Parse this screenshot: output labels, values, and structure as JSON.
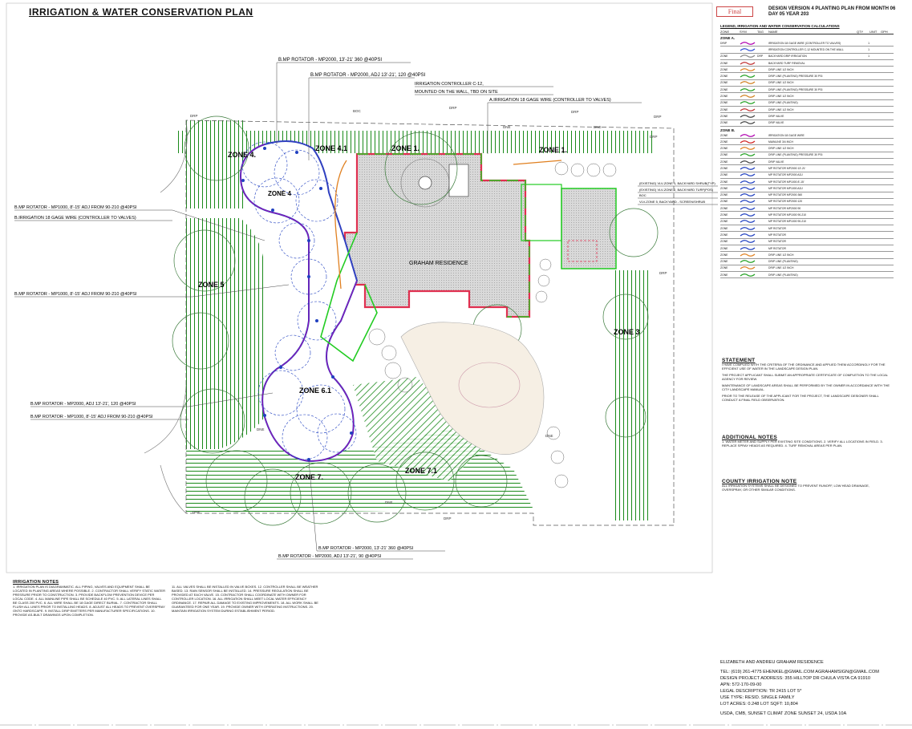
{
  "title": "IRRIGATION & WATER CONSERVATION PLAN",
  "final_stamp": "Final",
  "design_version": {
    "line1": "DESIGN VERSION 4 PLANTING PLAN FROM MONTH 06",
    "line2": "DAY 05 YEAR 203"
  },
  "plan": {
    "residence": "GRAHAM RESIDENCE",
    "zones": [
      "ZONE 4.",
      "ZONE 4.1",
      "ZONE 1.",
      "ZONE 1.",
      "ZONE 5",
      "ZONE 6.1",
      "ZONE 7.",
      "ZONE 7.1",
      "ZONE 3"
    ],
    "zone_inner": "ZONE 4",
    "controller_callout_1": "IRRIGATION CONTROLLER C-12,",
    "controller_callout_2": "MOUNTED ON THE WALL, TBD ON SITE",
    "callouts": {
      "rot_top_1": "B.MP ROTATOR - MP2000, 13'-21' 360 @40PSI",
      "rot_top_2": "B.MP ROTATOR - MP2000, ADJ 13'-21', 120 @40PSI",
      "wire_top": "A.IRRIGATION 18 GAGE WIRE (CONTROLLER TO VALVES)",
      "rot_left_1": "B.MP ROTATOR - MP1000, 8'-15' ADJ FROM 90-210 @40PSI",
      "wire_left": "B.IRRIGATION 18 GAGE WIRE (CONTROLLER TO VALVES)",
      "rot_left_2": "B.MP ROTATOR - MP1000, 8'-15' ADJ FROM 90-210 @40PSI",
      "rot_bl_1": "B.MP ROTATOR - MP2000, ADJ 13'-21', 120 @40PSI",
      "rot_bl_2": "B.MP ROTATOR - MP1000, 8'-15' ADJ FROM 90-210 @40PSI",
      "rot_bot_1": "B.MP ROTATOR - MP2000, 13'-21' 360 @40PSI",
      "rot_bot_2": "B.MP ROTATOR - MP2000, ADJ 13'-21', 90 @40PSI",
      "valve_1": "(EXISTING) VLV-ZONE 1, BACKYARD SHRUB(TYP)",
      "valve_2": "(EXISTING) VLV-ZONE 2, BACKYARD TURF(POS)",
      "valve_3": "VLV-ZONE 5, BACKYARD - SCREEN/SHRUB",
      "boc": "BOC",
      "drp": "DRP",
      "dne": "DNE"
    }
  },
  "legend": {
    "title": "LEGEND, IRRIGATION AND WATER CONSERVATION CALCULATIONS",
    "headers": [
      "ZONE",
      "SYM",
      "TAG",
      "NAME",
      "QTY",
      "UNIT",
      "GPH"
    ],
    "zone_a": "ZONE A.",
    "zone_b": "ZONE B.",
    "rows": [
      {
        "c1": "DRIP",
        "color": "#b000b0",
        "tag": "",
        "name": "IRRIGATION 18 GAGE WIRE (CONTROLLER TO VALVES)",
        "qty": "1",
        "unit": "",
        "gph": ""
      },
      {
        "c1": "",
        "color": "#3050d0",
        "tag": "",
        "name": "IRRIGATION CONTROLLER C-12 MOUNTED ON THE WALL",
        "qty": "1",
        "unit": "",
        "gph": ""
      },
      {
        "c1": "ZONE",
        "color": "#888",
        "tag": "DRP",
        "name": "BACKYARD DRIP IRRIGATION",
        "qty": "1",
        "unit": "",
        "gph": ""
      },
      {
        "c1": "ZONE",
        "color": "#c03030",
        "tag": "",
        "name": "BACKYARD TURF REMOVAL",
        "qty": "",
        "unit": "",
        "gph": ""
      },
      {
        "c1": "ZONE",
        "color": "#e08020",
        "tag": "",
        "name": "DRIP LINE 1/2 INCH",
        "qty": "",
        "unit": "",
        "gph": ""
      },
      {
        "c1": "ZONE",
        "color": "#20a020",
        "tag": "",
        "name": "DRIP LINE (PLANTING) PRESSURE 30 PSI",
        "qty": "",
        "unit": "",
        "gph": ""
      },
      {
        "c1": "ZONE",
        "color": "#d08020",
        "tag": "",
        "name": "DRIP LINE 1/2 INCH",
        "qty": "",
        "unit": "",
        "gph": ""
      },
      {
        "c1": "ZONE",
        "color": "#20a020",
        "tag": "",
        "name": "DRIP LINE (PLANTING) PRESSURE 30 PSI",
        "qty": "",
        "unit": "",
        "gph": ""
      },
      {
        "c1": "ZONE",
        "color": "#d08020",
        "tag": "",
        "name": "DRIP LINE 1/2 INCH",
        "qty": "",
        "unit": "",
        "gph": ""
      },
      {
        "c1": "ZONE",
        "color": "#20a020",
        "tag": "",
        "name": "DRIP LINE (PLANTING)",
        "qty": "",
        "unit": "",
        "gph": ""
      },
      {
        "c1": "ZONE",
        "color": "#c03030",
        "tag": "",
        "name": "DRIP LINE 1/2 INCH",
        "qty": "",
        "unit": "",
        "gph": ""
      },
      {
        "c1": "ZONE",
        "color": "#444",
        "tag": "",
        "name": "DRIP VALVE",
        "qty": "",
        "unit": "",
        "gph": ""
      },
      {
        "c1": "ZONE",
        "color": "#444",
        "tag": "",
        "name": "DRIP VALVE",
        "qty": "",
        "unit": "",
        "gph": ""
      },
      {
        "c1": "ZONE",
        "color": "#b000b0",
        "tag": "",
        "name": "IRRIGATION 18 GAGE WIRE",
        "qty": "",
        "unit": "",
        "gph": ""
      },
      {
        "c1": "ZONE",
        "color": "#d02020",
        "tag": "",
        "name": "MAINLINE 3/4 INCH",
        "qty": "",
        "unit": "",
        "gph": ""
      },
      {
        "c1": "ZONE",
        "color": "#e08020",
        "tag": "",
        "name": "DRIP LINE 1/2 INCH",
        "qty": "",
        "unit": "",
        "gph": ""
      },
      {
        "c1": "ZONE",
        "color": "#20a020",
        "tag": "",
        "name": "DRIP LINE (PLANTING) PRESSURE 30 PSI",
        "qty": "",
        "unit": "",
        "gph": ""
      },
      {
        "c1": "ZONE",
        "color": "#444",
        "tag": "",
        "name": "DRIP VALVE",
        "qty": "",
        "unit": "",
        "gph": ""
      },
      {
        "c1": "ZONE",
        "color": "#2040c0",
        "tag": "",
        "name": "MP ROTATOR MP2000 13'-21'",
        "qty": "",
        "unit": "",
        "gph": ""
      },
      {
        "c1": "ZONE",
        "color": "#2040c0",
        "tag": "",
        "name": "MP ROTATOR MP2000 ADJ",
        "qty": "",
        "unit": "",
        "gph": ""
      },
      {
        "c1": "ZONE",
        "color": "#2040c0",
        "tag": "",
        "name": "MP ROTATOR MP1000 8'-15'",
        "qty": "",
        "unit": "",
        "gph": ""
      },
      {
        "c1": "ZONE",
        "color": "#2040c0",
        "tag": "",
        "name": "MP ROTATOR MP1000 ADJ",
        "qty": "",
        "unit": "",
        "gph": ""
      },
      {
        "c1": "ZONE",
        "color": "#2040c0",
        "tag": "",
        "name": "MP ROTATOR MP2000 360",
        "qty": "",
        "unit": "",
        "gph": ""
      },
      {
        "c1": "ZONE",
        "color": "#2040c0",
        "tag": "",
        "name": "MP ROTATOR MP2000 120",
        "qty": "",
        "unit": "",
        "gph": ""
      },
      {
        "c1": "ZONE",
        "color": "#2040c0",
        "tag": "",
        "name": "MP ROTATOR MP2000 90",
        "qty": "",
        "unit": "",
        "gph": ""
      },
      {
        "c1": "ZONE",
        "color": "#2040c0",
        "tag": "",
        "name": "MP ROTATOR MP1000 90-210",
        "qty": "",
        "unit": "",
        "gph": ""
      },
      {
        "c1": "ZONE",
        "color": "#2040c0",
        "tag": "",
        "name": "MP ROTATOR MP1000 90-210",
        "qty": "",
        "unit": "",
        "gph": ""
      },
      {
        "c1": "ZONE",
        "color": "#2040c0",
        "tag": "",
        "name": "MP ROTATOR",
        "qty": "",
        "unit": "",
        "gph": ""
      },
      {
        "c1": "ZONE",
        "color": "#2040c0",
        "tag": "",
        "name": "MP ROTATOR",
        "qty": "",
        "unit": "",
        "gph": ""
      },
      {
        "c1": "ZONE",
        "color": "#2040c0",
        "tag": "",
        "name": "MP ROTATOR",
        "qty": "",
        "unit": "",
        "gph": ""
      },
      {
        "c1": "ZONE",
        "color": "#2040c0",
        "tag": "",
        "name": "MP ROTATOR",
        "qty": "",
        "unit": "",
        "gph": ""
      },
      {
        "c1": "ZONE",
        "color": "#e08020",
        "tag": "",
        "name": "DRIP LINE 1/2 INCH",
        "qty": "",
        "unit": "",
        "gph": ""
      },
      {
        "c1": "ZONE",
        "color": "#20a020",
        "tag": "",
        "name": "DRIP LINE (PLANTING)",
        "qty": "",
        "unit": "",
        "gph": ""
      },
      {
        "c1": "ZONE",
        "color": "#e08020",
        "tag": "",
        "name": "DRIP LINE 1/2 INCH",
        "qty": "",
        "unit": "",
        "gph": ""
      },
      {
        "c1": "ZONE",
        "color": "#20a020",
        "tag": "",
        "name": "DRIP LINE (PLANTING)",
        "qty": "",
        "unit": "",
        "gph": ""
      }
    ]
  },
  "statement": {
    "heading": "STATEMENT",
    "p1": "I HAVE COMPLIED WITH THE CRITERIA OF THE ORDINANCE AND APPLIED THEM ACCORDINGLY FOR THE EFFICIENT USE OF WATER IN THE LANDSCAPE DESIGN PLAN.",
    "p2": "THE PROJECT APPLICANT SHALL SUBMIT AN APPROPRIATE CERTIFICATE OF COMPLETION TO THE LOCAL AGENCY FOR REVIEW.",
    "p3": "MAINTENANCE OF LANDSCAPE AREAS SHALL BE PERFORMED BY THE OWNER IN ACCORDANCE WITH THE CITY LANDSCAPE MANUAL.",
    "p4": "PRIOR TO THE RELEASE OF THE APPLICANT FOR THE PROJECT, THE LANDSCAPE DESIGNER SHALL CONDUCT A FINAL FIELD OBSERVATION."
  },
  "additional_notes": {
    "heading": "ADDITIONAL NOTES",
    "body": "1. WATER METER AND SUPPLY PER EXISTING SITE CONDITIONS. 2. VERIFY ALL LOCATIONS IN FIELD. 3. REPLACE SPRAY HEADS AS REQUIRED. 4. TURF REMOVAL AREAS PER PLAN."
  },
  "county_notes": {
    "heading": "COUNTY IRRIGATION NOTE",
    "body": "ALL IRRIGATION SYSTEMS SHALL BE DESIGNED TO PREVENT RUNOFF, LOW HEAD DRAINAGE, OVERSPRAY, OR OTHER SIMILAR CONDITIONS."
  },
  "irrigation_notes": {
    "heading": "IRRIGATION NOTES",
    "col1": "1. IRRIGATION PLAN IS DIAGRAMMATIC. ALL PIPING, VALVES AND EQUIPMENT SHALL BE LOCATED IN PLANTING AREAS WHERE POSSIBLE. 2. CONTRACTOR SHALL VERIFY STATIC WATER PRESSURE PRIOR TO CONSTRUCTION. 3. PROVIDE BACKFLOW PREVENTION DEVICE PER LOCAL CODE. 4. ALL MAINLINE PIPE SHALL BE SCHEDULE 40 PVC. 5. ALL LATERAL LINES SHALL BE CLASS 200 PVC. 6. ALL WIRE SHALL BE 18 GAGE DIRECT BURIAL. 7. CONTRACTOR SHALL FLUSH ALL LINES PRIOR TO INSTALLING HEADS. 8. ADJUST ALL HEADS TO PREVENT OVERSPRAY ONTO HARDSCAPE. 9. INSTALL DRIP EMITTERS PER MANUFACTURER SPECIFICATIONS. 10. PROVIDE AS-BUILT DRAWINGS UPON COMPLETION.",
    "col2": "11. ALL VALVES SHALL BE INSTALLED IN VALVE BOXES. 12. CONTROLLER SHALL BE WEATHER BASED. 13. RAIN SENSOR SHALL BE INSTALLED. 14. PRESSURE REGULATION SHALL BE PROVIDED AT EACH VALVE. 15. CONTRACTOR SHALL COORDINATE WITH OWNER FOR CONTROLLER LOCATION. 16. ALL IRRIGATION SHALL MEET LOCAL WATER EFFICIENCY ORDINANCE. 17. REPAIR ALL DAMAGE TO EXISTING IMPROVEMENTS. 18. ALL WORK SHALL BE GUARANTEED FOR ONE YEAR. 19. PROVIDE OWNER WITH OPERATING INSTRUCTIONS. 20. MAINTAIN IRRIGATION SYSTEM DURING ESTABLISHMENT PERIOD."
  },
  "project_info": {
    "l1": "ELIZABETH AND ANDREU GRAHAM RESIDENCE",
    "l2": "TEL: (619) 261-4775  EHENKEL@GMAIL.COM  AGRAHAMSIGN@GMAIL.COM",
    "l3": "DESIGN PROJECT ADDRESS: 355 HILLTOP DR CHULA VISTA CA 91910",
    "l4": "APN:    572-170-09-00",
    "l5": "LEGAL DESCRIPTION: TR 2415 LOT 5*",
    "l6": "USE TYPE: RESID. SINGLE FAMILY",
    "l7": "LOT ACRES: 0.248  LOT SQFT: 10,804",
    "l8": "USDA, CMB, SUNSET CLIMAT ZONE SUNSET 24, USDA 10A"
  }
}
